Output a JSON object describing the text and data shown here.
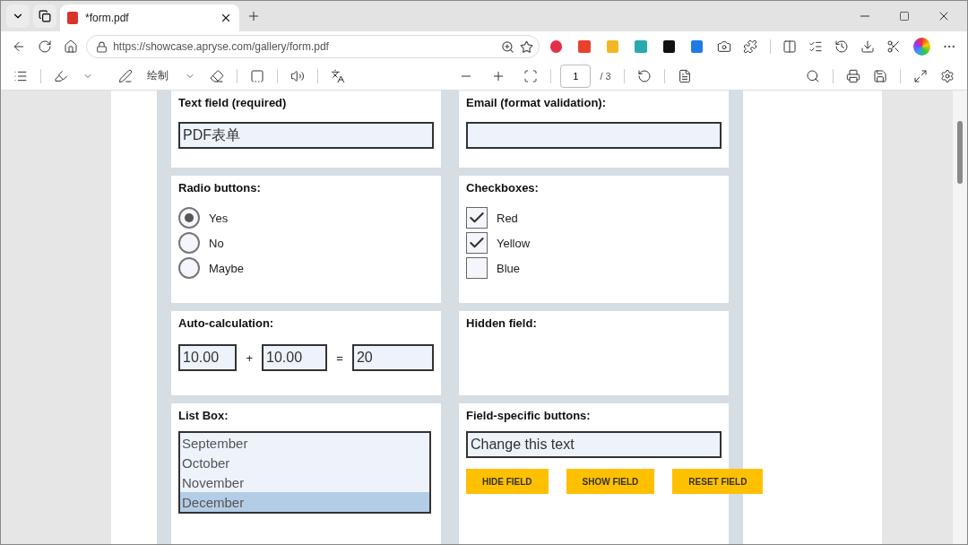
{
  "browser": {
    "tab": {
      "title": "*form.pdf",
      "selected": true
    },
    "url": "https://showcase.apryse.com/gallery/form.pdf"
  },
  "pdf_toolbar": {
    "draw_label": "绘制",
    "page": "1",
    "page_total": "/ 3"
  },
  "form": {
    "sections": [
      {
        "kind": "text",
        "title": "Text field (required)",
        "value": "PDF表单"
      },
      {
        "kind": "text",
        "title": "Email (format validation):"
      },
      {
        "kind": "radio",
        "title": "Radio buttons:",
        "options": [
          {
            "label": "Yes",
            "selected": true
          },
          {
            "label": "No",
            "selected": false
          },
          {
            "label": "Maybe",
            "selected": false
          }
        ]
      },
      {
        "kind": "checkbox",
        "title": "Checkboxes:",
        "options": [
          {
            "label": "Red",
            "checked": true
          },
          {
            "label": "Yellow",
            "checked": true
          },
          {
            "label": "Blue",
            "checked": false
          }
        ]
      },
      {
        "kind": "calc",
        "title": "Auto-calculation:",
        "a": "10.00",
        "plus": "+",
        "b": "10.00",
        "equals": "=",
        "result": "20"
      },
      {
        "kind": "hidden",
        "title": "Hidden field:"
      },
      {
        "kind": "listbox",
        "title": "List Box:",
        "items": [
          {
            "label": "September",
            "selected": false
          },
          {
            "label": "October",
            "selected": false
          },
          {
            "label": "November",
            "selected": false
          },
          {
            "label": "December",
            "selected": true
          }
        ]
      },
      {
        "kind": "buttons",
        "title": "Field-specific buttons:",
        "value": "Change this text",
        "buttons": [
          "HIDE FIELD",
          "SHOW FIELD",
          "RESET FIELD"
        ]
      }
    ]
  }
}
